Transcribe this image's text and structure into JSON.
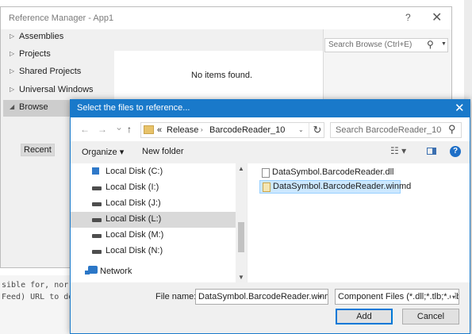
{
  "background": {
    "code_lines": [
      "sible for, nor d",
      "Feed) URL to det"
    ]
  },
  "reference_manager": {
    "title": "Reference Manager - App1",
    "help_glyph": "?",
    "close_glyph": "✕",
    "nav_items": [
      {
        "label": "Assemblies",
        "arrow": "▷"
      },
      {
        "label": "Projects",
        "arrow": "▷"
      },
      {
        "label": "Shared Projects",
        "arrow": "▷"
      },
      {
        "label": "Universal Windows",
        "arrow": "▷"
      },
      {
        "label": "Browse",
        "arrow": "◢"
      }
    ],
    "recent_label": "Recent",
    "no_items_text": "No items found.",
    "search_placeholder": "Search Browse (Ctrl+E)"
  },
  "file_dialog": {
    "title": "Select the files to reference...",
    "close_glyph": "✕",
    "back_glyph": "←",
    "forward_glyph": "→",
    "recent_drop_glyph": "⌄",
    "up_glyph": "↑",
    "breadcrumb_prefix": "«",
    "breadcrumbs": [
      "Release",
      "BarcodeReader_10"
    ],
    "crumb_separator": "›",
    "refresh_glyph": "↻",
    "search_placeholder": "Search BarcodeReader_10",
    "toolbar": {
      "organize_label": "Organize",
      "new_folder_label": "New folder",
      "help_glyph": "?"
    },
    "tree_items": [
      {
        "label": "Local Disk (C:)"
      },
      {
        "label": "Local Disk (I:)"
      },
      {
        "label": "Local Disk (J:)"
      },
      {
        "label": "Local Disk (L:)"
      },
      {
        "label": "Local Disk (M:)"
      },
      {
        "label": "Local Disk (N:)"
      },
      {
        "label": "Network"
      }
    ],
    "files": [
      {
        "name": "DataSymbol.BarcodeReader.dll"
      },
      {
        "name": "DataSymbol.BarcodeReader.winmd"
      }
    ],
    "file_name_label": "File name:",
    "file_name_value": "DataSymbol.BarcodeReader.winmd",
    "file_type_value": "Component Files (*.dll;*.tlb;*.olb;*.ocx;*.exe;*.manifest)",
    "add_label": "Add",
    "cancel_label": "Cancel"
  }
}
